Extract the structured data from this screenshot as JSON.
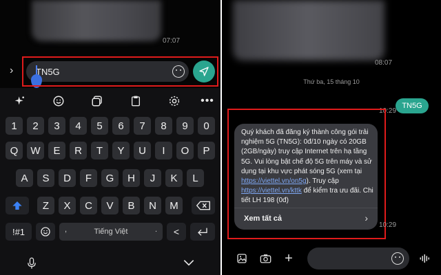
{
  "left": {
    "timestamp": "07:07",
    "input": {
      "value": "TN5G"
    },
    "keyboard": {
      "rows": [
        [
          "1",
          "2",
          "3",
          "4",
          "5",
          "6",
          "7",
          "8",
          "9",
          "0"
        ],
        [
          "Q",
          "W",
          "E",
          "R",
          "T",
          "Y",
          "U",
          "I",
          "O",
          "P"
        ],
        [
          "A",
          "S",
          "D",
          "F",
          "G",
          "H",
          "J",
          "K",
          "L"
        ],
        [
          "Z",
          "X",
          "C",
          "V",
          "B",
          "N",
          "M"
        ]
      ],
      "symbols_key": "!#1",
      "space_label": "Tiếng Việt",
      "comma": ",",
      "period": "."
    }
  },
  "right": {
    "timestamp_top": "08:07",
    "date_separator": "Thứ ba, 15 tháng 10",
    "timestamp_sent": "10:29",
    "sent_message": "TN5G",
    "received_message": {
      "text_1": "Quý khách đã đăng ký thành công gói trải nghiệm 5G (TN5G): 0đ/10 ngày có 20GB (2GB/ngày) truy cập Internet trên hạ tầng 5G. Vui lòng bật chế độ 5G trên máy và sử dụng tại khu vực phát sóng 5G (xem tại ",
      "link_1": "https://viettel.vn/on5g",
      "text_2": "). Truy cập ",
      "link_2": "https://viettel.vn/kttk",
      "text_3": " để kiểm tra ưu đãi. Chi tiết LH 198 (0đ)",
      "see_all": "Xem tất cả"
    },
    "timestamp_received": "10:29"
  },
  "colors": {
    "accent": "#2aa58f",
    "highlight": "#e01b1b",
    "link": "#7fa8f5"
  }
}
